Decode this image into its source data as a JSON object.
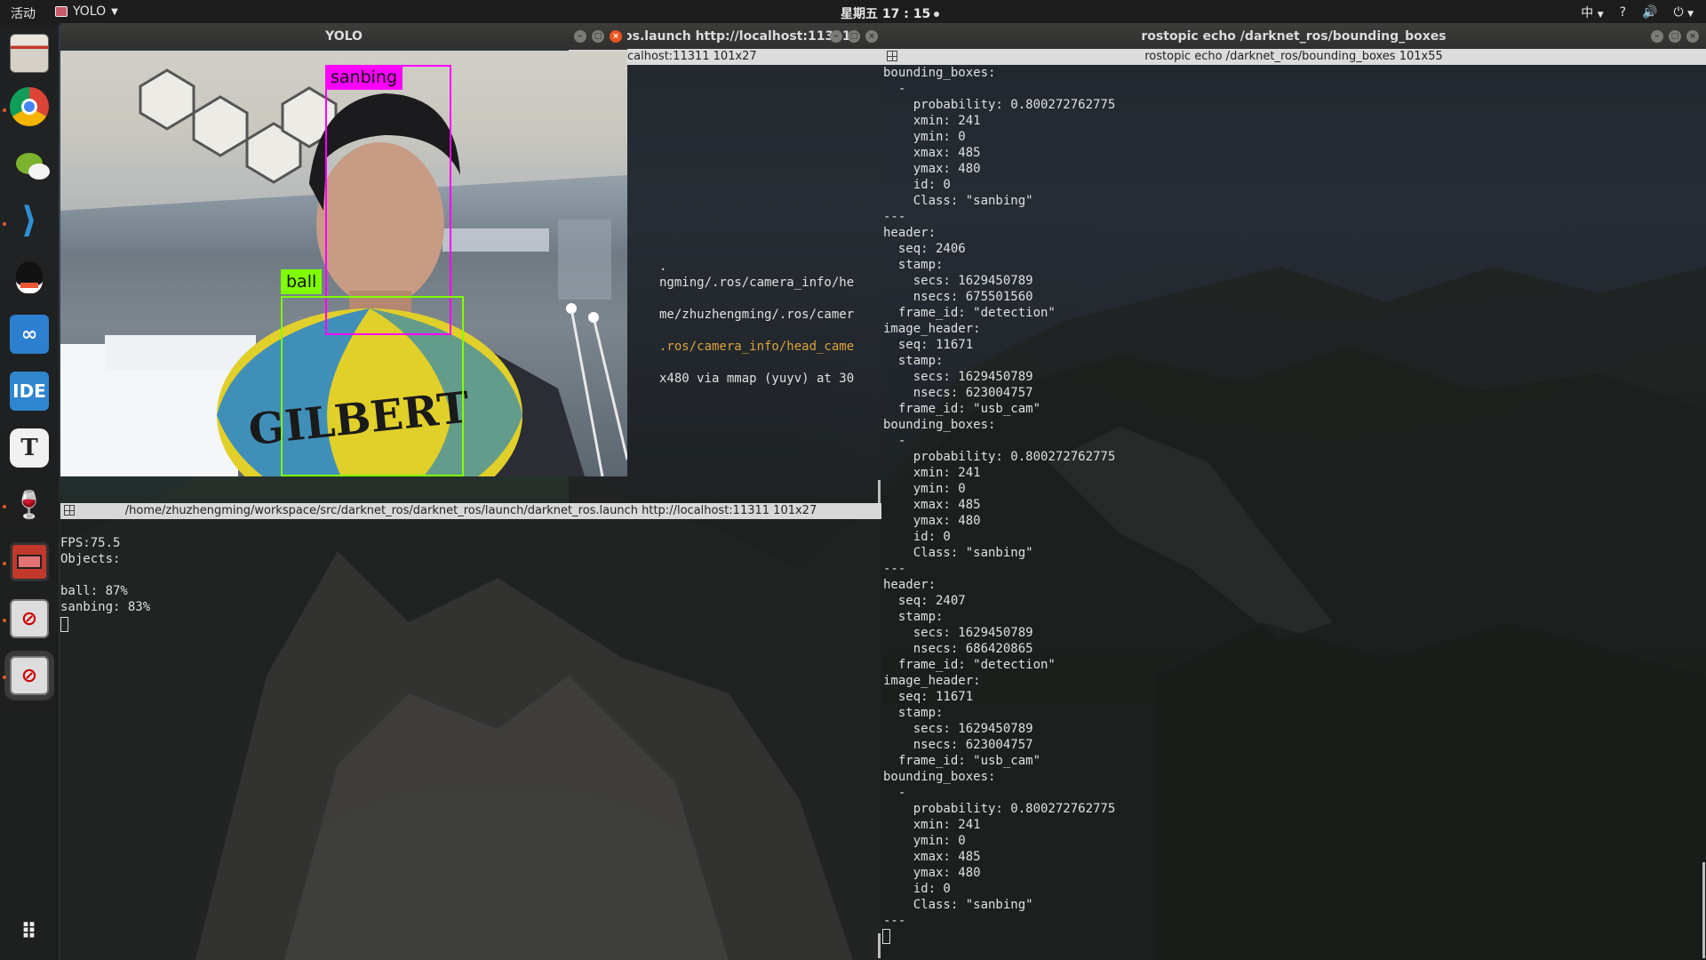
{
  "topbar": {
    "activities": "活动",
    "app_name": "YOLO",
    "clock": "星期五 17 : 15",
    "input_method": "中",
    "help": "?"
  },
  "dock": {
    "items": [
      {
        "name": "files-icon"
      },
      {
        "name": "chrome-icon"
      },
      {
        "name": "wechat-icon"
      },
      {
        "name": "vscode-icon"
      },
      {
        "name": "qq-icon"
      },
      {
        "name": "cloud-icon"
      },
      {
        "name": "ide-icon",
        "label": "IDE"
      },
      {
        "name": "typora-icon",
        "label": "T"
      },
      {
        "name": "wine-icon"
      },
      {
        "name": "screen-recorder-icon"
      },
      {
        "name": "blocked-app-icon"
      },
      {
        "name": "blocked-app-icon-2"
      },
      {
        "name": "app-grid-icon"
      }
    ]
  },
  "yolo_window": {
    "title": "YOLO",
    "detections": [
      {
        "label": "sanbing",
        "color": "#ff00ff"
      },
      {
        "label": "ball",
        "color": "#7fff00"
      }
    ],
    "image_text": "GILBERT"
  },
  "launch_window": {
    "title": "os.launch http://localhost:11311",
    "tab_title": "calhost:11311 101x27",
    "lines": [
      "",
      "",
      "",
      "",
      "",
      "",
      "",
      "",
      "",
      "",
      "",
      "",
      ".",
      "ngming/.ros/camera_info/he",
      "",
      "me/zhuzhengming/.ros/camer",
      "",
      ".ros/camera_info/head_came",
      "",
      "x480 via mmap (yuyv) at 30"
    ]
  },
  "fps_window": {
    "tab_title": "/home/zhuzhengming/workspace/src/darknet_ros/darknet_ros/launch/darknet_ros.launch http://localhost:11311 101x27",
    "lines": [
      "FPS:75.5",
      "Objects:",
      "",
      "ball: 87%",
      "sanbing: 83%"
    ]
  },
  "echo_window": {
    "title": "rostopic echo /darknet_ros/bounding_boxes",
    "tab_title": "rostopic echo /darknet_ros/bounding_boxes 101x55",
    "lines": [
      "bounding_boxes:",
      "  -",
      "    probability: 0.800272762775",
      "    xmin: 241",
      "    ymin: 0",
      "    xmax: 485",
      "    ymax: 480",
      "    id: 0",
      "    Class: \"sanbing\"",
      "---",
      "header:",
      "  seq: 2406",
      "  stamp:",
      "    secs: 1629450789",
      "    nsecs: 675501560",
      "  frame_id: \"detection\"",
      "image_header:",
      "  seq: 11671",
      "  stamp:",
      "    secs: 1629450789",
      "    nsecs: 623004757",
      "  frame_id: \"usb_cam\"",
      "bounding_boxes:",
      "  -",
      "    probability: 0.800272762775",
      "    xmin: 241",
      "    ymin: 0",
      "    xmax: 485",
      "    ymax: 480",
      "    id: 0",
      "    Class: \"sanbing\"",
      "---",
      "header:",
      "  seq: 2407",
      "  stamp:",
      "    secs: 1629450789",
      "    nsecs: 686420865",
      "  frame_id: \"detection\"",
      "image_header:",
      "  seq: 11671",
      "  stamp:",
      "    secs: 1629450789",
      "    nsecs: 623004757",
      "  frame_id: \"usb_cam\"",
      "bounding_boxes:",
      "  -",
      "    probability: 0.800272762775",
      "    xmin: 241",
      "    ymin: 0",
      "    xmax: 485",
      "    ymax: 480",
      "    id: 0",
      "    Class: \"sanbing\"",
      "---"
    ]
  }
}
